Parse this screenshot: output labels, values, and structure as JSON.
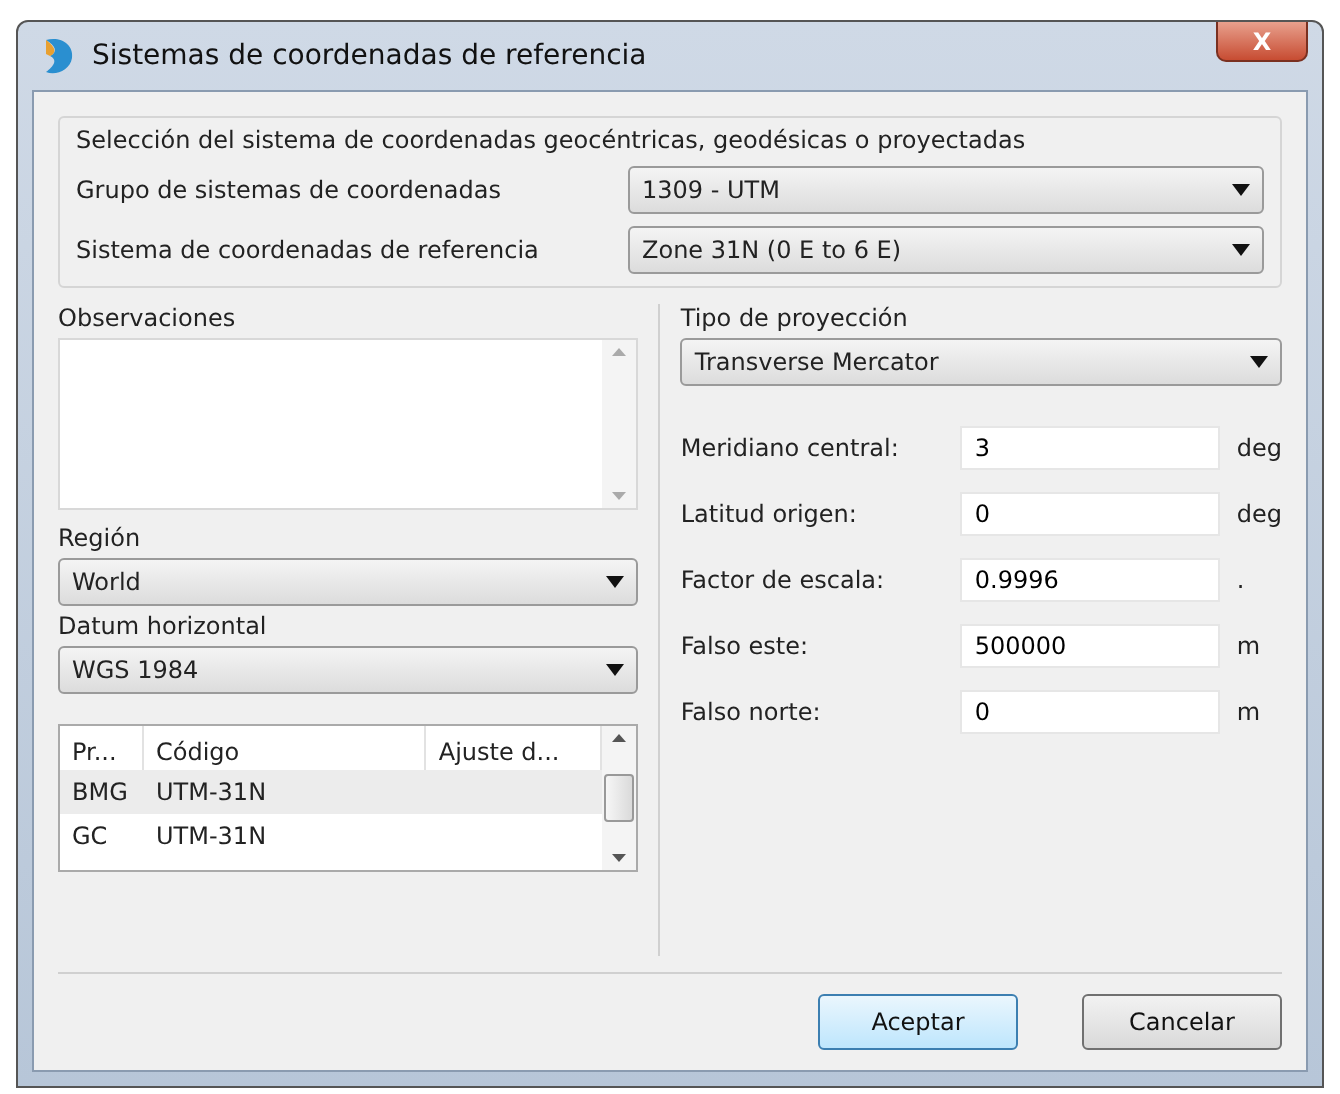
{
  "window": {
    "title": "Sistemas de coordenadas de referencia",
    "close": "X"
  },
  "selection": {
    "title": "Selección del sistema de coordenadas geocéntricas, geodésicas o proyectadas",
    "fields": [
      {
        "label": "Grupo de sistemas de coordenadas",
        "value": "1309 - UTM"
      },
      {
        "label": "Sistema de coordenadas de referencia",
        "value": "Zone 31N (0 E to 6 E)"
      }
    ]
  },
  "observations": {
    "label": "Observaciones"
  },
  "region": {
    "label": "Región",
    "value": "World"
  },
  "datum": {
    "label": "Datum horizontal",
    "value": "WGS 1984"
  },
  "table": {
    "columns": [
      "Pr...",
      "Código",
      "Ajuste d..."
    ],
    "rows": [
      {
        "cells": [
          "BMG",
          "UTM-31N",
          ""
        ],
        "selected": true
      },
      {
        "cells": [
          "GC",
          "UTM-31N",
          ""
        ],
        "selected": false
      }
    ]
  },
  "projection": {
    "label": "Tipo de proyección",
    "value": "Transverse Mercator",
    "params": [
      {
        "label": "Meridiano central:",
        "value": "3",
        "unit": "deg"
      },
      {
        "label": "Latitud origen:",
        "value": "0",
        "unit": "deg"
      },
      {
        "label": "Factor de escala:",
        "value": "0.9996",
        "unit": "."
      },
      {
        "label": "Falso este:",
        "value": "500000",
        "unit": "m"
      },
      {
        "label": "Falso norte:",
        "value": "0",
        "unit": "m"
      }
    ]
  },
  "buttons": [
    {
      "label": "Aceptar",
      "default": true
    },
    {
      "label": "Cancelar",
      "default": false
    }
  ]
}
